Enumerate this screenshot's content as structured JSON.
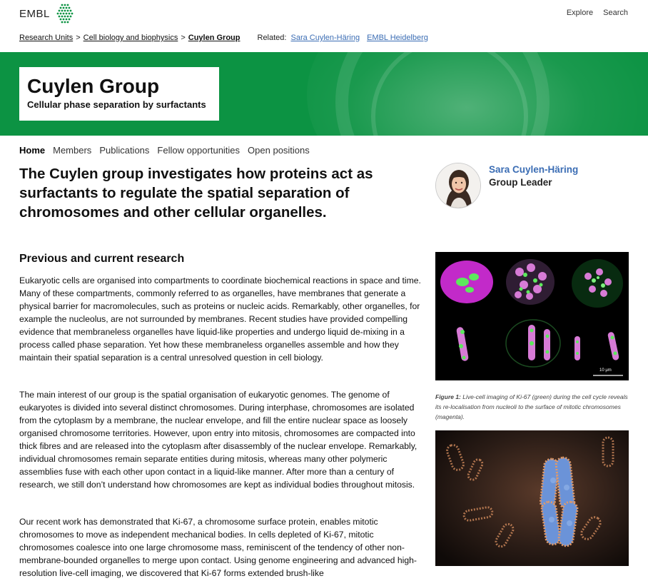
{
  "header": {
    "logo_text": "EMBL",
    "nav": [
      "Explore",
      "Search"
    ]
  },
  "breadcrumb": {
    "items": [
      "Research Units",
      "Cell biology and biophysics",
      "Cuylen Group"
    ],
    "related_label": "Related:",
    "related": [
      "Sara Cuylen-Häring",
      "EMBL Heidelberg"
    ]
  },
  "banner": {
    "title": "Cuylen Group",
    "subtitle": "Cellular phase separation by surfactants",
    "color": "#0c9343"
  },
  "section_nav": [
    "Home",
    "Members",
    "Publications",
    "Fellow opportunities",
    "Open positions"
  ],
  "lead": "The Cuylen group investigates how proteins act as surfactants to regulate the spatial separation of chromosomes and other cellular organelles.",
  "person": {
    "name": "Sara Cuylen-Häring",
    "role": "Group Leader"
  },
  "content": {
    "heading": "Previous and current research",
    "paragraphs": [
      "Eukaryotic cells are organised into compartments to coordinate biochemical reactions in space and time. Many of these compartments, commonly referred to as organelles, have membranes that generate a physical barrier for macromolecules, such as proteins or nucleic acids. Remarkably, other organelles, for example the nucleolus, are not surrounded by membranes. Recent studies have provided compelling evidence that membraneless organelles have liquid-like properties and undergo liquid de-mixing in a process called phase separation. Yet how these membraneless organelles assemble and how they maintain their spatial separation is a central unresolved question in cell biology.",
      "The main interest of our group is the spatial organisation of eukaryotic genomes. The genome of eukaryotes is divided into several distinct chromosomes. During interphase, chromosomes are isolated from the cytoplasm by a membrane, the nuclear envelope, and fill the entire nuclear space as loosely organised chromosome territories. However, upon entry into mitosis, chromosomes are compacted into thick fibres and are released into the cytoplasm after disassembly of the nuclear envelope. Remarkably, individual chromosomes remain separate entities during mitosis, whereas many other polymeric assemblies fuse with each other upon contact in a liquid-like manner. After more than a century of research, we still don’t understand how chromosomes are kept as individual bodies throughout mitosis.",
      "Our recent work has demonstrated that Ki-67, a chromosome surface protein, enables mitotic chromosomes to move as independent mechanical bodies. In cells depleted of Ki-67, mitotic chromosomes coalesce into one large chromosome mass, reminiscent of the tendency of other non-membrane-bounded organelles to merge upon contact. Using genome engineering and advanced high-resolution live-cell imaging, we discovered that Ki-67 forms extended brush-like"
    ]
  },
  "figure1": {
    "label": "Figure 1:",
    "caption": "Live-cell imaging of Ki-67 (green) during the cell cycle reveals its re-localisation from nucleoli to the surface of mitotic chromosomes (magenta).",
    "scale": "10 μm"
  }
}
